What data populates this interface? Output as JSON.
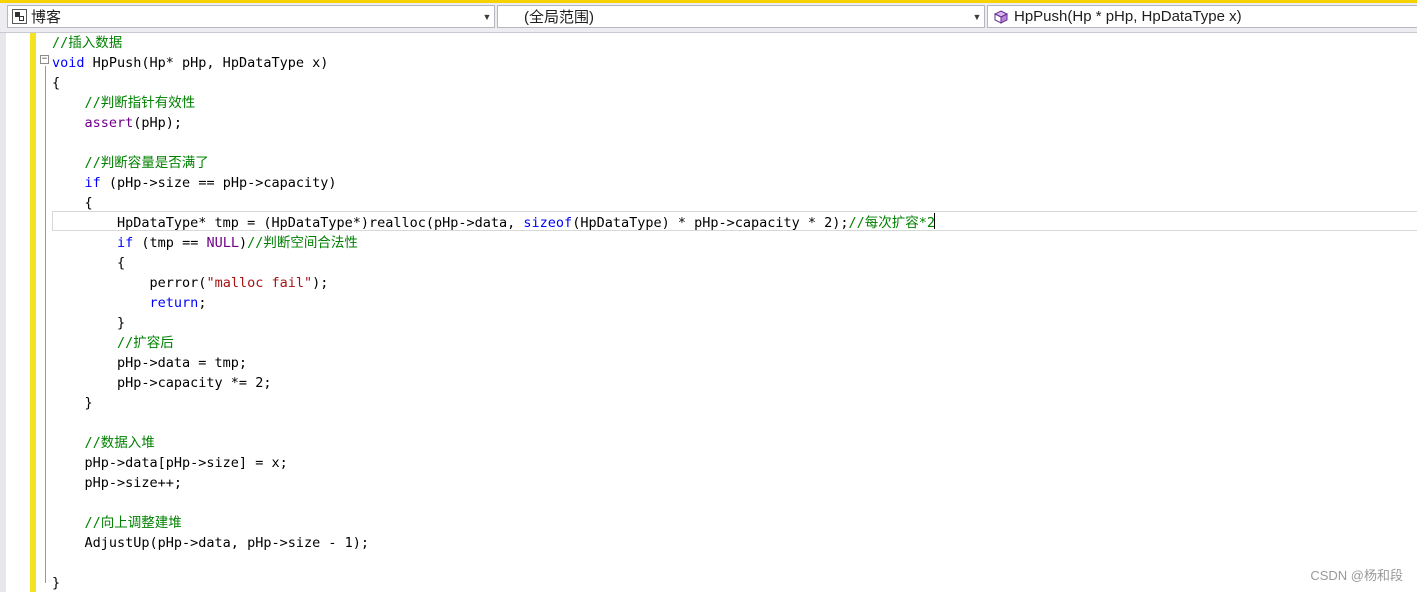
{
  "navbar": {
    "accent_color": "#f5d200",
    "project_combo": {
      "icon": "project-icon",
      "value": "博客"
    },
    "scope_combo": {
      "value": "(全局范围)"
    },
    "member_combo": {
      "icon": "function-cube-icon",
      "value": "HpPush(Hp * pHp, HpDataType x)"
    }
  },
  "editor": {
    "change_bar_color": "#f5e321",
    "collapse_glyph": "−",
    "active_line_index": 9,
    "code_lines": [
      [
        {
          "t": "//插入数据",
          "c": "cm"
        }
      ],
      [
        {
          "t": "void",
          "c": "kw"
        },
        {
          "t": " HpPush(Hp* pHp, HpDataType x)",
          "c": ""
        }
      ],
      [
        {
          "t": "{",
          "c": ""
        }
      ],
      [
        {
          "t": "    ",
          "c": ""
        },
        {
          "t": "//判断指针有效性",
          "c": "cm"
        }
      ],
      [
        {
          "t": "    ",
          "c": ""
        },
        {
          "t": "assert",
          "c": "mc"
        },
        {
          "t": "(pHp);",
          "c": ""
        }
      ],
      [],
      [
        {
          "t": "    ",
          "c": ""
        },
        {
          "t": "//判断容量是否满了",
          "c": "cm"
        }
      ],
      [
        {
          "t": "    ",
          "c": ""
        },
        {
          "t": "if",
          "c": "kw"
        },
        {
          "t": " (pHp->size == pHp->capacity)",
          "c": ""
        }
      ],
      [
        {
          "t": "    {",
          "c": ""
        }
      ],
      [
        {
          "t": "        HpDataType* tmp = (HpDataType*)realloc(pHp->data, ",
          "c": ""
        },
        {
          "t": "sizeof",
          "c": "kw"
        },
        {
          "t": "(HpDataType) * pHp->capacity * 2);",
          "c": ""
        },
        {
          "t": "//每次扩容*2",
          "c": "cm"
        }
      ],
      [
        {
          "t": "        ",
          "c": ""
        },
        {
          "t": "if",
          "c": "kw"
        },
        {
          "t": " (tmp == ",
          "c": ""
        },
        {
          "t": "NULL",
          "c": "mc"
        },
        {
          "t": ")",
          "c": ""
        },
        {
          "t": "//判断空间合法性",
          "c": "cm"
        }
      ],
      [
        {
          "t": "        {",
          "c": ""
        }
      ],
      [
        {
          "t": "            perror(",
          "c": ""
        },
        {
          "t": "\"malloc fail\"",
          "c": "st"
        },
        {
          "t": ");",
          "c": ""
        }
      ],
      [
        {
          "t": "            ",
          "c": ""
        },
        {
          "t": "return",
          "c": "kw"
        },
        {
          "t": ";",
          "c": ""
        }
      ],
      [
        {
          "t": "        }",
          "c": ""
        }
      ],
      [
        {
          "t": "        ",
          "c": ""
        },
        {
          "t": "//扩容后",
          "c": "cm"
        }
      ],
      [
        {
          "t": "        pHp->data = tmp;",
          "c": ""
        }
      ],
      [
        {
          "t": "        pHp->capacity *= 2;",
          "c": ""
        }
      ],
      [
        {
          "t": "    }",
          "c": ""
        }
      ],
      [],
      [
        {
          "t": "    ",
          "c": ""
        },
        {
          "t": "//数据入堆",
          "c": "cm"
        }
      ],
      [
        {
          "t": "    pHp->data[pHp->size] = x;",
          "c": ""
        }
      ],
      [
        {
          "t": "    pHp->size++;",
          "c": ""
        }
      ],
      [],
      [
        {
          "t": "    ",
          "c": ""
        },
        {
          "t": "//向上调整建堆",
          "c": "cm"
        }
      ],
      [
        {
          "t": "    AdjustUp(pHp->data, pHp->size - 1);",
          "c": ""
        }
      ],
      [],
      [
        {
          "t": "}",
          "c": ""
        }
      ]
    ]
  },
  "watermark": "CSDN @杨和段"
}
